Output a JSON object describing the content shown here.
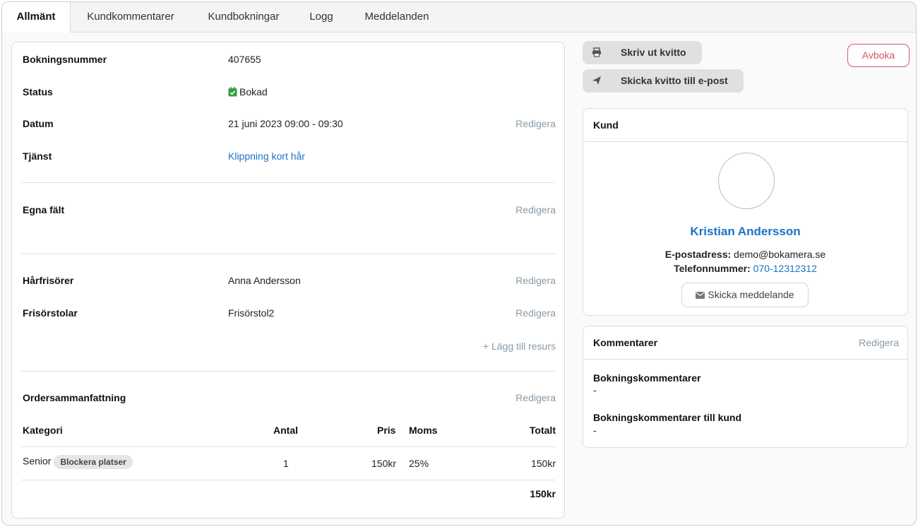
{
  "tabs": [
    "Allmänt",
    "Kundkommentarer",
    "Kundbokningar",
    "Logg",
    "Meddelanden"
  ],
  "booking": {
    "number_label": "Bokningsnummer",
    "number": "407655",
    "status_label": "Status",
    "status": "Bokad",
    "date_label": "Datum",
    "date": "21 juni 2023 09:00 - 09:30",
    "service_label": "Tjänst",
    "service": "Klippning kort hår",
    "edit": "Redigera"
  },
  "custom_fields": {
    "label": "Egna fält",
    "edit": "Redigera"
  },
  "resources": {
    "hairdresser_label": "Hårfrisörer",
    "hairdresser": "Anna Andersson",
    "chair_label": "Frisörstolar",
    "chair": "Frisörstol2",
    "add": "+ Lägg till resurs",
    "edit": "Redigera"
  },
  "order": {
    "title": "Ordersammanfattning",
    "edit": "Redigera",
    "headers": {
      "category": "Kategori",
      "qty": "Antal",
      "price": "Pris",
      "vat": "Moms",
      "total": "Totalt"
    },
    "row": {
      "category": "Senior",
      "badge": "Blockera platser",
      "qty": "1",
      "price": "150kr",
      "vat": "25%",
      "total": "150kr"
    },
    "sum": "150kr"
  },
  "actions": {
    "print": "Skriv ut kvitto",
    "email": "Skicka kvitto till e-post",
    "cancel": "Avboka"
  },
  "customer": {
    "title": "Kund",
    "name": "Kristian Andersson",
    "email_label": "E-postadress:",
    "email": "demo@bokamera.se",
    "phone_label": "Telefonnummer:",
    "phone": "070-12312312",
    "message_btn": "Skicka meddelande"
  },
  "comments": {
    "title": "Kommentarer",
    "edit": "Redigera",
    "booking_label": "Bokningskommentarer",
    "booking_value": "-",
    "customer_label": "Bokningskommentarer till kund",
    "customer_value": "-"
  },
  "colors": {
    "link": "#1a73c8",
    "edit": "#8a9aa6",
    "danger": "#d9536b",
    "status_icon": "#2e9e3e"
  }
}
